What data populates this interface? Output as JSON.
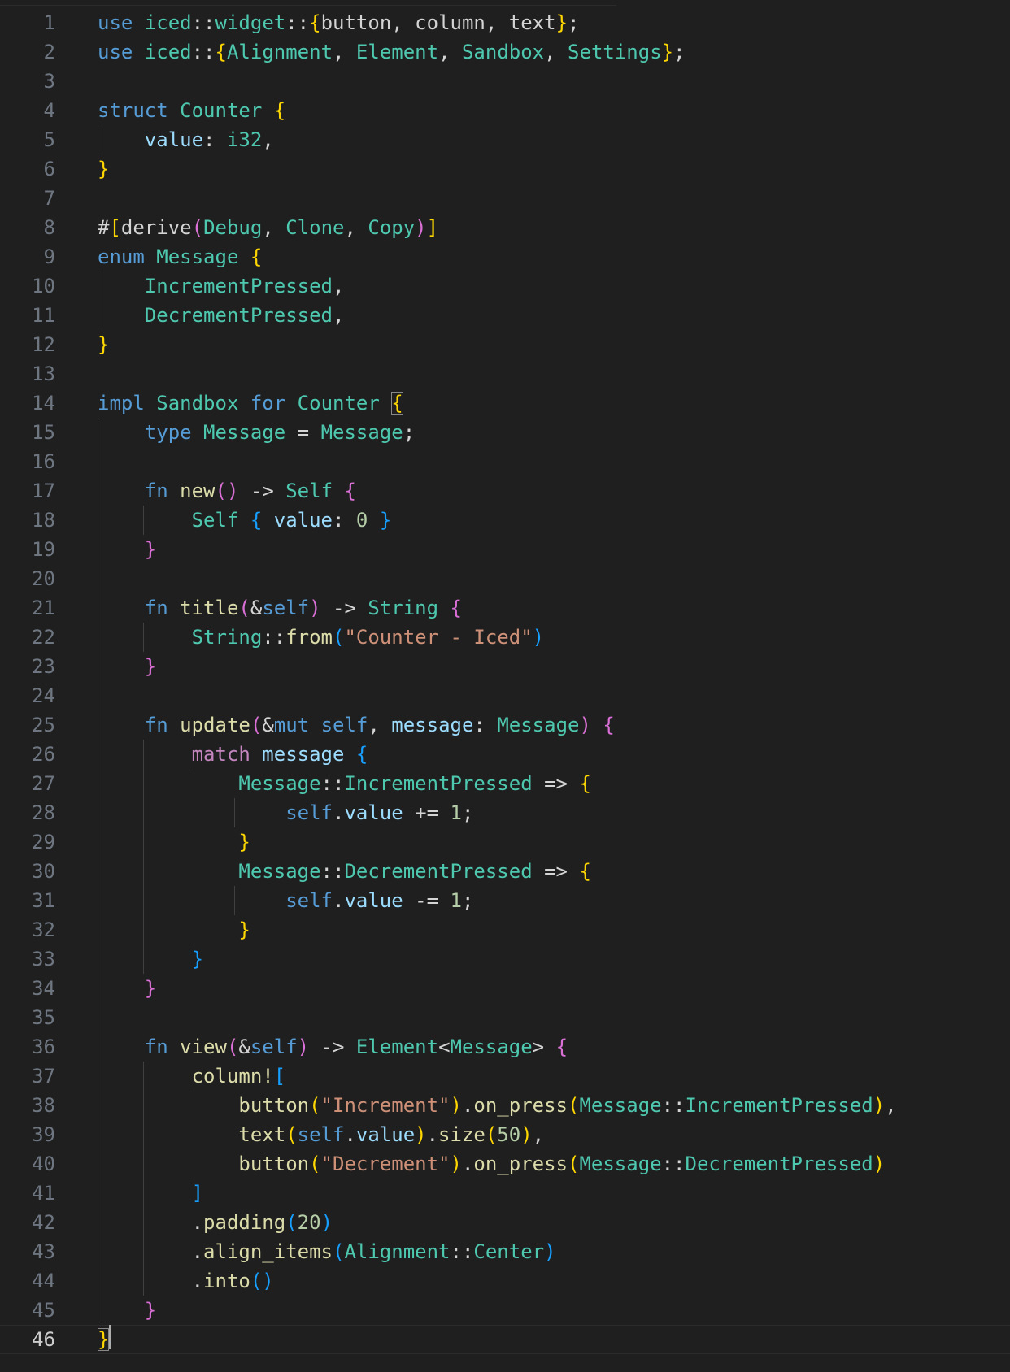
{
  "editor": {
    "language": "rust",
    "current_line": 46,
    "colors": {
      "background": "#1f1f1f",
      "line_number": "#6e7681",
      "keyword": "#569cd6",
      "control_keyword": "#c586c0",
      "type": "#4ec9b0",
      "function": "#dcdcaa",
      "variable": "#9cdcfe",
      "string": "#ce9178",
      "number": "#b5cea8",
      "bracket_level_1": "#ffd700",
      "bracket_level_2": "#da70d6",
      "bracket_level_3": "#179fff"
    },
    "lines": [
      {
        "n": "1",
        "guides": 0,
        "tokens": [
          [
            "kw",
            "use"
          ],
          [
            "p",
            " "
          ],
          [
            "type",
            "iced"
          ],
          [
            "p",
            "::"
          ],
          [
            "type",
            "widget"
          ],
          [
            "p",
            "::"
          ],
          [
            "b1",
            "{"
          ],
          [
            "p",
            "button, column, text"
          ],
          [
            "b1",
            "}"
          ],
          [
            "p",
            ";"
          ]
        ]
      },
      {
        "n": "2",
        "guides": 0,
        "tokens": [
          [
            "kw",
            "use"
          ],
          [
            "p",
            " "
          ],
          [
            "type",
            "iced"
          ],
          [
            "p",
            "::"
          ],
          [
            "b1",
            "{"
          ],
          [
            "type",
            "Alignment"
          ],
          [
            "p",
            ", "
          ],
          [
            "type",
            "Element"
          ],
          [
            "p",
            ", "
          ],
          [
            "type",
            "Sandbox"
          ],
          [
            "p",
            ", "
          ],
          [
            "type",
            "Settings"
          ],
          [
            "b1",
            "}"
          ],
          [
            "p",
            ";"
          ]
        ]
      },
      {
        "n": "3",
        "guides": 0,
        "tokens": []
      },
      {
        "n": "4",
        "guides": 0,
        "tokens": [
          [
            "kw",
            "struct"
          ],
          [
            "p",
            " "
          ],
          [
            "type",
            "Counter"
          ],
          [
            "p",
            " "
          ],
          [
            "b1",
            "{"
          ]
        ]
      },
      {
        "n": "5",
        "guides": 1,
        "tokens": [
          [
            "p",
            "    "
          ],
          [
            "var",
            "value"
          ],
          [
            "p",
            ": "
          ],
          [
            "type",
            "i32"
          ],
          [
            "p",
            ","
          ]
        ]
      },
      {
        "n": "6",
        "guides": 0,
        "tokens": [
          [
            "b1",
            "}"
          ]
        ]
      },
      {
        "n": "7",
        "guides": 0,
        "tokens": []
      },
      {
        "n": "8",
        "guides": 0,
        "tokens": [
          [
            "p",
            "#"
          ],
          [
            "b1",
            "["
          ],
          [
            "p",
            "derive"
          ],
          [
            "b2",
            "("
          ],
          [
            "type",
            "Debug"
          ],
          [
            "p",
            ", "
          ],
          [
            "type",
            "Clone"
          ],
          [
            "p",
            ", "
          ],
          [
            "type",
            "Copy"
          ],
          [
            "b2",
            ")"
          ],
          [
            "b1",
            "]"
          ]
        ]
      },
      {
        "n": "9",
        "guides": 0,
        "tokens": [
          [
            "kw",
            "enum"
          ],
          [
            "p",
            " "
          ],
          [
            "type",
            "Message"
          ],
          [
            "p",
            " "
          ],
          [
            "b1",
            "{"
          ]
        ]
      },
      {
        "n": "10",
        "guides": 1,
        "tokens": [
          [
            "p",
            "    "
          ],
          [
            "type",
            "IncrementPressed"
          ],
          [
            "p",
            ","
          ]
        ]
      },
      {
        "n": "11",
        "guides": 1,
        "tokens": [
          [
            "p",
            "    "
          ],
          [
            "type",
            "DecrementPressed"
          ],
          [
            "p",
            ","
          ]
        ]
      },
      {
        "n": "12",
        "guides": 0,
        "tokens": [
          [
            "b1",
            "}"
          ]
        ]
      },
      {
        "n": "13",
        "guides": 0,
        "tokens": []
      },
      {
        "n": "14",
        "guides": 0,
        "tokens": [
          [
            "kw",
            "impl"
          ],
          [
            "p",
            " "
          ],
          [
            "type",
            "Sandbox"
          ],
          [
            "p",
            " "
          ],
          [
            "kw",
            "for"
          ],
          [
            "p",
            " "
          ],
          [
            "type",
            "Counter"
          ],
          [
            "p",
            " "
          ],
          [
            "bm",
            "{"
          ]
        ]
      },
      {
        "n": "15",
        "guides": 1,
        "tokens": [
          [
            "p",
            "    "
          ],
          [
            "kw",
            "type"
          ],
          [
            "p",
            " "
          ],
          [
            "type",
            "Message"
          ],
          [
            "p",
            " = "
          ],
          [
            "type",
            "Message"
          ],
          [
            "p",
            ";"
          ]
        ]
      },
      {
        "n": "16",
        "guides": 1,
        "tokens": []
      },
      {
        "n": "17",
        "guides": 1,
        "tokens": [
          [
            "p",
            "    "
          ],
          [
            "kw",
            "fn"
          ],
          [
            "p",
            " "
          ],
          [
            "fn",
            "new"
          ],
          [
            "b2",
            "()"
          ],
          [
            "p",
            " -> "
          ],
          [
            "type",
            "Self"
          ],
          [
            "p",
            " "
          ],
          [
            "b2",
            "{"
          ]
        ]
      },
      {
        "n": "18",
        "guides": 2,
        "tokens": [
          [
            "p",
            "        "
          ],
          [
            "type",
            "Self"
          ],
          [
            "p",
            " "
          ],
          [
            "b3",
            "{"
          ],
          [
            "p",
            " "
          ],
          [
            "var",
            "value"
          ],
          [
            "p",
            ": "
          ],
          [
            "num",
            "0"
          ],
          [
            "p",
            " "
          ],
          [
            "b3",
            "}"
          ]
        ]
      },
      {
        "n": "19",
        "guides": 1,
        "tokens": [
          [
            "p",
            "    "
          ],
          [
            "b2",
            "}"
          ]
        ]
      },
      {
        "n": "20",
        "guides": 1,
        "tokens": []
      },
      {
        "n": "21",
        "guides": 1,
        "tokens": [
          [
            "p",
            "    "
          ],
          [
            "kw",
            "fn"
          ],
          [
            "p",
            " "
          ],
          [
            "fn",
            "title"
          ],
          [
            "b2",
            "("
          ],
          [
            "p",
            "&"
          ],
          [
            "kw",
            "self"
          ],
          [
            "b2",
            ")"
          ],
          [
            "p",
            " -> "
          ],
          [
            "type",
            "String"
          ],
          [
            "p",
            " "
          ],
          [
            "b2",
            "{"
          ]
        ]
      },
      {
        "n": "22",
        "guides": 2,
        "tokens": [
          [
            "p",
            "        "
          ],
          [
            "type",
            "String"
          ],
          [
            "p",
            "::"
          ],
          [
            "fn",
            "from"
          ],
          [
            "b3",
            "("
          ],
          [
            "str",
            "\"Counter - Iced\""
          ],
          [
            "b3",
            ")"
          ]
        ]
      },
      {
        "n": "23",
        "guides": 1,
        "tokens": [
          [
            "p",
            "    "
          ],
          [
            "b2",
            "}"
          ]
        ]
      },
      {
        "n": "24",
        "guides": 1,
        "tokens": []
      },
      {
        "n": "25",
        "guides": 1,
        "tokens": [
          [
            "p",
            "    "
          ],
          [
            "kw",
            "fn"
          ],
          [
            "p",
            " "
          ],
          [
            "fn",
            "update"
          ],
          [
            "b2",
            "("
          ],
          [
            "p",
            "&"
          ],
          [
            "kw",
            "mut self"
          ],
          [
            "p",
            ", "
          ],
          [
            "var",
            "message"
          ],
          [
            "p",
            ": "
          ],
          [
            "type",
            "Message"
          ],
          [
            "b2",
            ")"
          ],
          [
            "p",
            " "
          ],
          [
            "b2",
            "{"
          ]
        ]
      },
      {
        "n": "26",
        "guides": 2,
        "tokens": [
          [
            "p",
            "        "
          ],
          [
            "ctl",
            "match"
          ],
          [
            "p",
            " "
          ],
          [
            "var",
            "message"
          ],
          [
            "p",
            " "
          ],
          [
            "b3",
            "{"
          ]
        ]
      },
      {
        "n": "27",
        "guides": 3,
        "tokens": [
          [
            "p",
            "            "
          ],
          [
            "type",
            "Message"
          ],
          [
            "p",
            "::"
          ],
          [
            "type",
            "IncrementPressed"
          ],
          [
            "p",
            " => "
          ],
          [
            "b1",
            "{"
          ]
        ]
      },
      {
        "n": "28",
        "guides": 4,
        "tokens": [
          [
            "p",
            "                "
          ],
          [
            "kw",
            "self"
          ],
          [
            "p",
            "."
          ],
          [
            "var",
            "value"
          ],
          [
            "p",
            " += "
          ],
          [
            "num",
            "1"
          ],
          [
            "p",
            ";"
          ]
        ]
      },
      {
        "n": "29",
        "guides": 3,
        "tokens": [
          [
            "p",
            "            "
          ],
          [
            "b1",
            "}"
          ]
        ]
      },
      {
        "n": "30",
        "guides": 3,
        "tokens": [
          [
            "p",
            "            "
          ],
          [
            "type",
            "Message"
          ],
          [
            "p",
            "::"
          ],
          [
            "type",
            "DecrementPressed"
          ],
          [
            "p",
            " => "
          ],
          [
            "b1",
            "{"
          ]
        ]
      },
      {
        "n": "31",
        "guides": 4,
        "tokens": [
          [
            "p",
            "                "
          ],
          [
            "kw",
            "self"
          ],
          [
            "p",
            "."
          ],
          [
            "var",
            "value"
          ],
          [
            "p",
            " -= "
          ],
          [
            "num",
            "1"
          ],
          [
            "p",
            ";"
          ]
        ]
      },
      {
        "n": "32",
        "guides": 3,
        "tokens": [
          [
            "p",
            "            "
          ],
          [
            "b1",
            "}"
          ]
        ]
      },
      {
        "n": "33",
        "guides": 2,
        "tokens": [
          [
            "p",
            "        "
          ],
          [
            "b3",
            "}"
          ]
        ]
      },
      {
        "n": "34",
        "guides": 1,
        "tokens": [
          [
            "p",
            "    "
          ],
          [
            "b2",
            "}"
          ]
        ]
      },
      {
        "n": "35",
        "guides": 1,
        "tokens": []
      },
      {
        "n": "36",
        "guides": 1,
        "tokens": [
          [
            "p",
            "    "
          ],
          [
            "kw",
            "fn"
          ],
          [
            "p",
            " "
          ],
          [
            "fn",
            "view"
          ],
          [
            "b2",
            "("
          ],
          [
            "p",
            "&"
          ],
          [
            "kw",
            "self"
          ],
          [
            "b2",
            ")"
          ],
          [
            "p",
            " -> "
          ],
          [
            "type",
            "Element"
          ],
          [
            "p",
            "<"
          ],
          [
            "type",
            "Message"
          ],
          [
            "p",
            "> "
          ],
          [
            "b2",
            "{"
          ]
        ]
      },
      {
        "n": "37",
        "guides": 2,
        "tokens": [
          [
            "p",
            "        "
          ],
          [
            "fn",
            "column!"
          ],
          [
            "b3",
            "["
          ]
        ]
      },
      {
        "n": "38",
        "guides": 3,
        "tokens": [
          [
            "p",
            "            "
          ],
          [
            "fn",
            "button"
          ],
          [
            "b1",
            "("
          ],
          [
            "str",
            "\"Increment\""
          ],
          [
            "b1",
            ")"
          ],
          [
            "p",
            "."
          ],
          [
            "fn",
            "on_press"
          ],
          [
            "b1",
            "("
          ],
          [
            "type",
            "Message"
          ],
          [
            "p",
            "::"
          ],
          [
            "type",
            "IncrementPressed"
          ],
          [
            "b1",
            ")"
          ],
          [
            "p",
            ","
          ]
        ]
      },
      {
        "n": "39",
        "guides": 3,
        "tokens": [
          [
            "p",
            "            "
          ],
          [
            "fn",
            "text"
          ],
          [
            "b1",
            "("
          ],
          [
            "kw",
            "self"
          ],
          [
            "p",
            "."
          ],
          [
            "var",
            "value"
          ],
          [
            "b1",
            ")"
          ],
          [
            "p",
            "."
          ],
          [
            "fn",
            "size"
          ],
          [
            "b1",
            "("
          ],
          [
            "num",
            "50"
          ],
          [
            "b1",
            ")"
          ],
          [
            "p",
            ","
          ]
        ]
      },
      {
        "n": "40",
        "guides": 3,
        "tokens": [
          [
            "p",
            "            "
          ],
          [
            "fn",
            "button"
          ],
          [
            "b1",
            "("
          ],
          [
            "str",
            "\"Decrement\""
          ],
          [
            "b1",
            ")"
          ],
          [
            "p",
            "."
          ],
          [
            "fn",
            "on_press"
          ],
          [
            "b1",
            "("
          ],
          [
            "type",
            "Message"
          ],
          [
            "p",
            "::"
          ],
          [
            "type",
            "DecrementPressed"
          ],
          [
            "b1",
            ")"
          ]
        ]
      },
      {
        "n": "41",
        "guides": 2,
        "tokens": [
          [
            "p",
            "        "
          ],
          [
            "b3",
            "]"
          ]
        ]
      },
      {
        "n": "42",
        "guides": 2,
        "tokens": [
          [
            "p",
            "        ."
          ],
          [
            "fn",
            "padding"
          ],
          [
            "b3",
            "("
          ],
          [
            "num",
            "20"
          ],
          [
            "b3",
            ")"
          ]
        ]
      },
      {
        "n": "43",
        "guides": 2,
        "tokens": [
          [
            "p",
            "        ."
          ],
          [
            "fn",
            "align_items"
          ],
          [
            "b3",
            "("
          ],
          [
            "type",
            "Alignment"
          ],
          [
            "p",
            "::"
          ],
          [
            "type",
            "Center"
          ],
          [
            "b3",
            ")"
          ]
        ]
      },
      {
        "n": "44",
        "guides": 2,
        "tokens": [
          [
            "p",
            "        ."
          ],
          [
            "fn",
            "into"
          ],
          [
            "b3",
            "()"
          ]
        ]
      },
      {
        "n": "45",
        "guides": 1,
        "tokens": [
          [
            "p",
            "    "
          ],
          [
            "b2",
            "}"
          ]
        ]
      },
      {
        "n": "46",
        "guides": 0,
        "tokens": [
          [
            "bm",
            "}"
          ]
        ]
      }
    ]
  }
}
